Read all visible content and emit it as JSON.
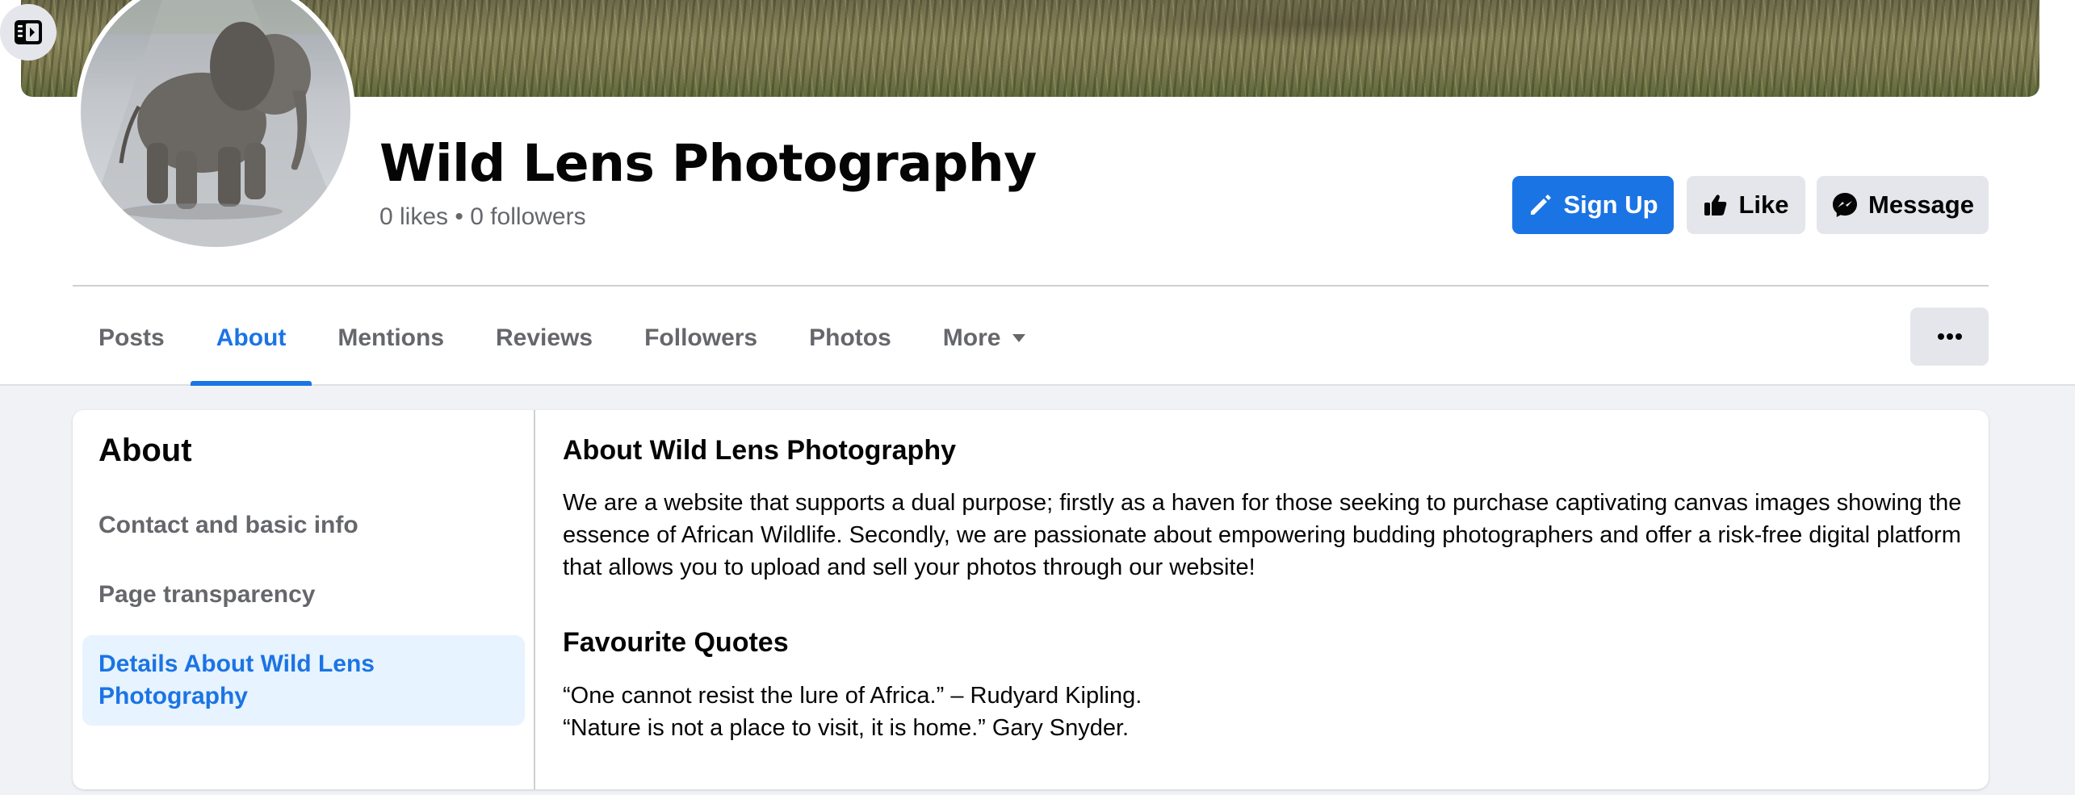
{
  "page": {
    "name": "Wild Lens Photography",
    "stats": "0 likes • 0 followers"
  },
  "actions": {
    "sign_up_label": "Sign Up",
    "like_label": "Like",
    "message_label": "Message"
  },
  "tabs": [
    {
      "label": "Posts",
      "active": false
    },
    {
      "label": "About",
      "active": true
    },
    {
      "label": "Mentions",
      "active": false
    },
    {
      "label": "Reviews",
      "active": false
    },
    {
      "label": "Followers",
      "active": false
    },
    {
      "label": "Photos",
      "active": false
    },
    {
      "label": "More",
      "active": false
    }
  ],
  "about": {
    "heading": "About",
    "nav": [
      {
        "label": "Contact and basic info",
        "active": false
      },
      {
        "label": "Page transparency",
        "active": false
      },
      {
        "label": "Details About Wild Lens Photography",
        "active": true
      }
    ],
    "sections": {
      "about_title": "About Wild Lens Photography",
      "about_text": "We are a website that supports a dual purpose; firstly as a haven for those seeking to purchase captivating canvas images showing the essence of African Wildlife. Secondly, we are passionate about empowering budding photographers and offer a risk-free digital platform that allows you to upload and sell your photos through our website!",
      "quotes_title": "Favourite Quotes",
      "quote_1": "“One cannot resist the lure of Africa.” – Rudyard Kipling.",
      "quote_2": "“Nature is not a place to visit, it is home.” Gary Snyder."
    }
  },
  "icons": {
    "sidebar_toggle": "sidebar-panel-icon",
    "sign_up": "pencil-icon",
    "like": "thumbs-up-icon",
    "message": "messenger-icon",
    "more_caret": "caret-down-icon",
    "options": "ellipsis-icon"
  },
  "colors": {
    "accent": "#1b74e4",
    "accent_light": "#e7f3ff",
    "secondary_button": "#e4e6eb",
    "muted_text": "#65676b",
    "background": "#f0f2f5"
  }
}
